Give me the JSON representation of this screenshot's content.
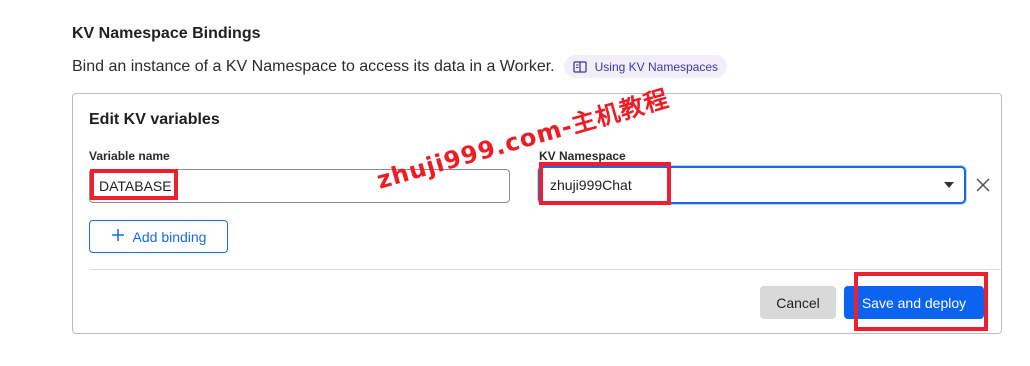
{
  "section": {
    "title": "KV Namespace Bindings",
    "description": "Bind an instance of a KV Namespace to access its data in a Worker.",
    "doc_link": "Using KV Namespaces"
  },
  "card": {
    "title": "Edit KV variables",
    "variable_label": "Variable name",
    "variable_value": "DATABASE",
    "namespace_label": "KV Namespace",
    "namespace_value": "zhuji999Chat",
    "add_binding": "Add binding",
    "cancel": "Cancel",
    "save": "Save and deploy"
  },
  "watermark": "zhuji999.com-主机教程",
  "colors": {
    "accent": "#0a64f0",
    "annotation": "#ee2030",
    "pill_bg": "#f2effa"
  },
  "icons": {
    "doc_link": "book-icon",
    "add": "plus-icon",
    "remove": "close-icon",
    "dropdown": "caret-down-icon"
  }
}
